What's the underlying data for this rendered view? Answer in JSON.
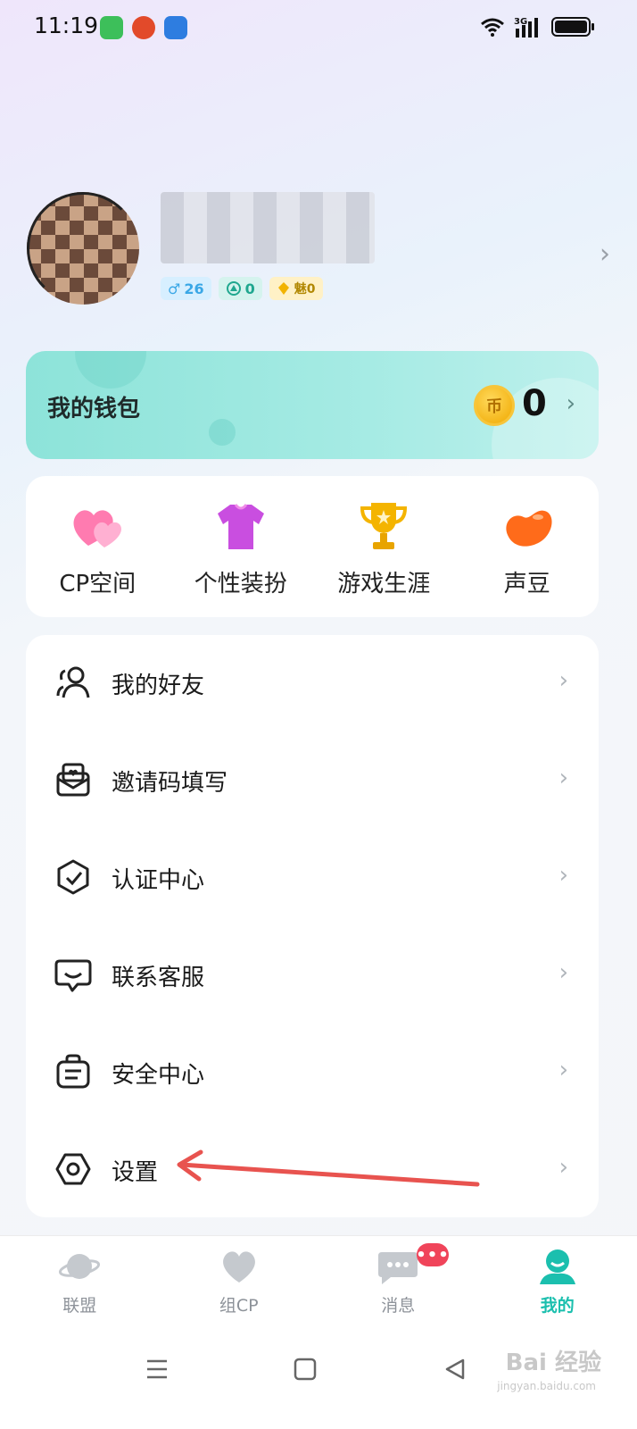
{
  "status_bar": {
    "time": "11:19",
    "network": "3G"
  },
  "profile": {
    "badges": {
      "age": "26",
      "level": "0",
      "charm": "魅0"
    }
  },
  "wallet": {
    "title": "我的钱包",
    "coin_label": "币",
    "balance": "0"
  },
  "features": [
    {
      "label": "CP空间",
      "icon": "hearts-icon"
    },
    {
      "label": "个性装扮",
      "icon": "shirt-icon"
    },
    {
      "label": "游戏生涯",
      "icon": "trophy-icon"
    },
    {
      "label": "声豆",
      "icon": "bean-icon"
    }
  ],
  "menu": [
    {
      "label": "我的好友",
      "icon": "friends-icon"
    },
    {
      "label": "邀请码填写",
      "icon": "invite-envelope-icon"
    },
    {
      "label": "认证中心",
      "icon": "shield-check-icon"
    },
    {
      "label": "联系客服",
      "icon": "chat-support-icon"
    },
    {
      "label": "安全中心",
      "icon": "security-bag-icon"
    },
    {
      "label": "设置",
      "icon": "settings-hexagon-icon"
    }
  ],
  "tabbar": {
    "tabs": [
      {
        "label": "联盟",
        "icon": "planet-icon",
        "active": false
      },
      {
        "label": "组CP",
        "icon": "heart-icon",
        "active": false
      },
      {
        "label": "消息",
        "icon": "message-icon",
        "active": false,
        "badge": "•••"
      },
      {
        "label": "我的",
        "icon": "profile-icon",
        "active": true
      }
    ]
  },
  "watermark": {
    "text": "Bai 经验",
    "sub": "jingyan.baidu.com"
  },
  "colors": {
    "accent": "#1bbfae",
    "badge_red": "#f0445a",
    "annotation_arrow": "#e8534f"
  }
}
